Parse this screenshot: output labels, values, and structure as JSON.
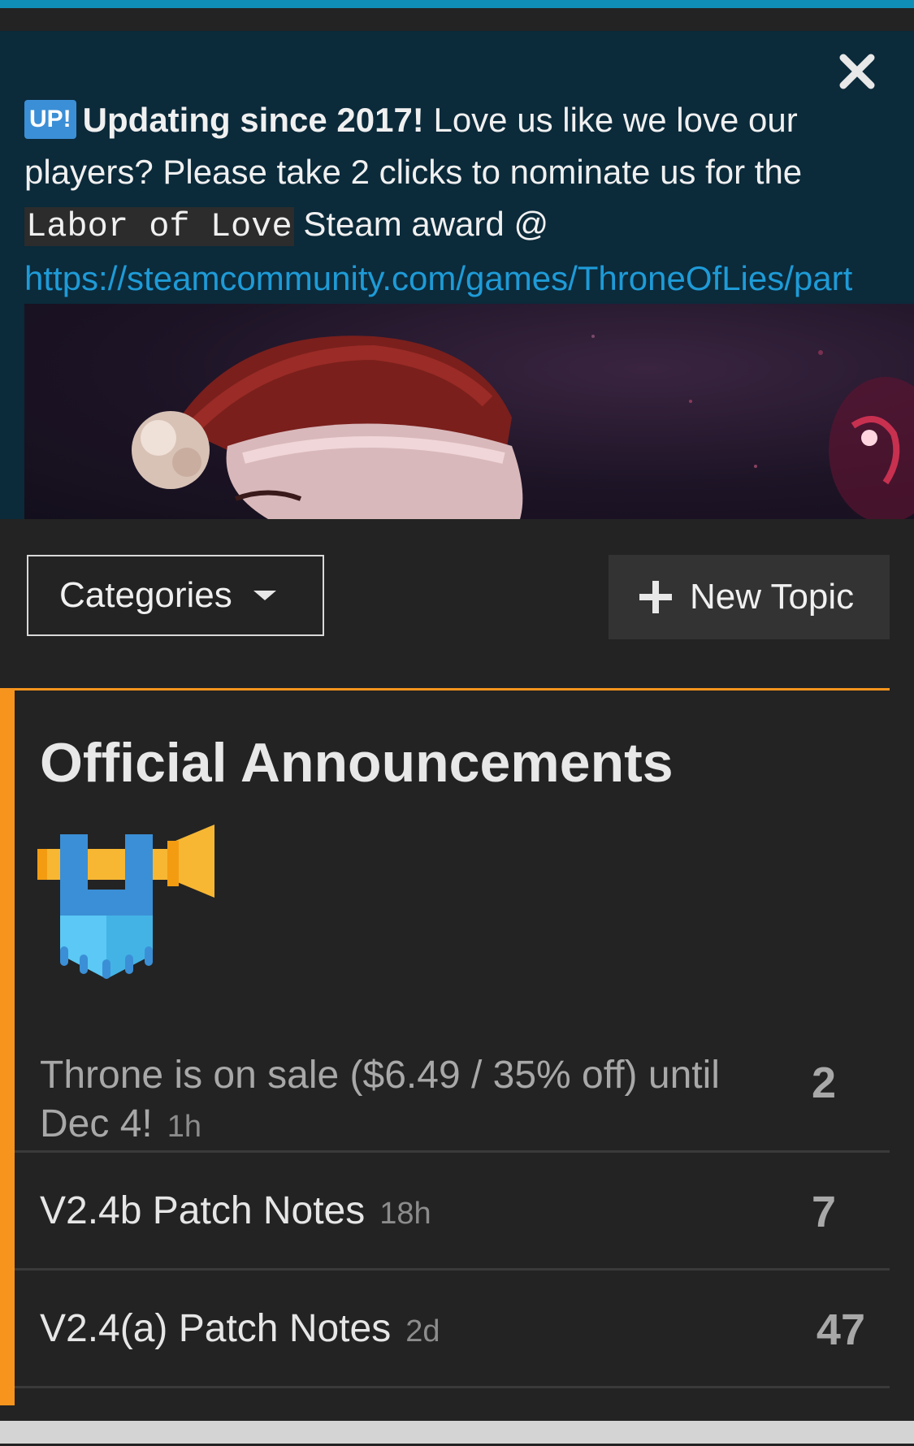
{
  "banner": {
    "badge": "UP!",
    "headline": "Updating since 2017!",
    "text1": " Love us like we love our players? Please take 2 clicks to nominate us for the ",
    "code": "Labor of Love",
    "text2": " Steam award @",
    "link": "https://steamcommunity.com/games/ThroneOfLies/part"
  },
  "toolbar": {
    "categories_label": "Categories",
    "new_topic_label": "New Topic"
  },
  "category": {
    "title": "Official Announcements",
    "accent_color": "#f7941d",
    "topics": [
      {
        "title": "Throne is on sale ($6.49 / 35% off) until Dec 4!",
        "age": "1h",
        "replies": "2"
      },
      {
        "title": "V2.4b Patch Notes",
        "age": "18h",
        "replies": "7"
      },
      {
        "title": "V2.4(a) Patch Notes",
        "age": "2d",
        "replies": "47"
      }
    ]
  },
  "colors": {
    "top_bar": "#0f8fb8",
    "banner_bg": "#0b2a3a",
    "link": "#1e9bd7",
    "page_bg": "#232323"
  }
}
